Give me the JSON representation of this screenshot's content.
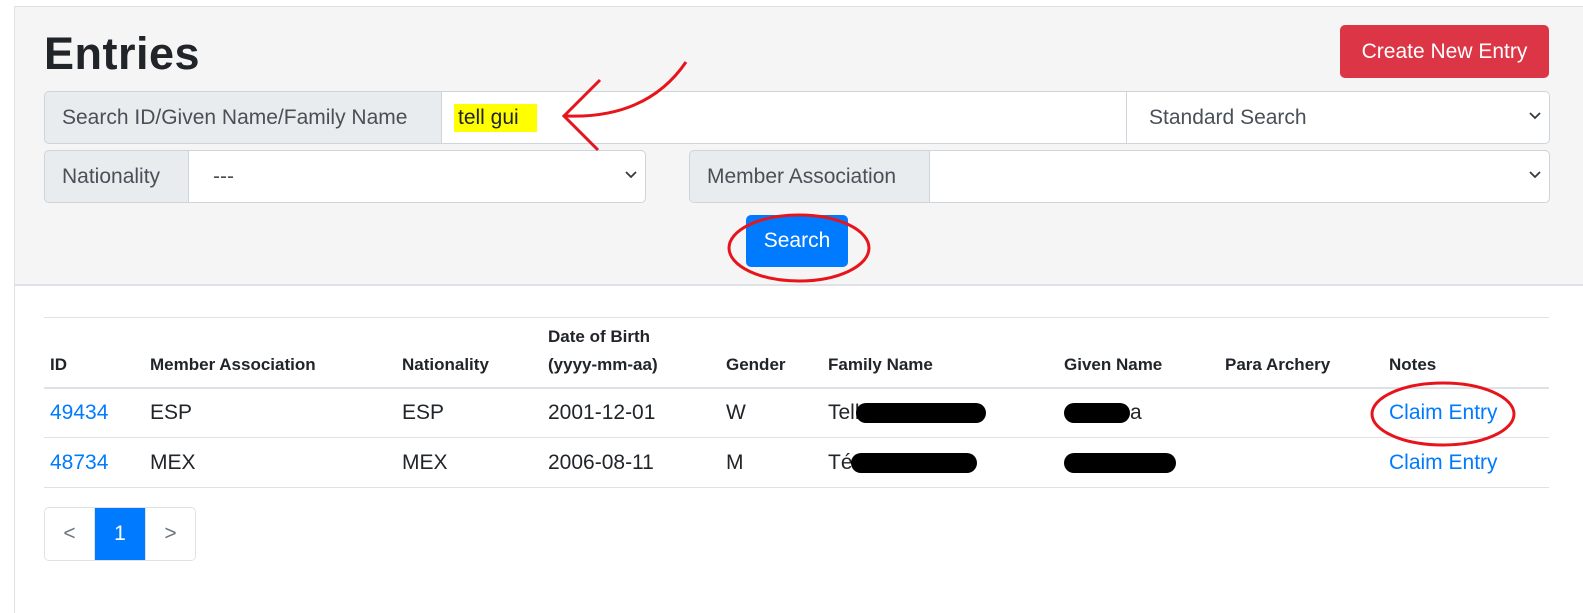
{
  "header": {
    "title": "Entries",
    "create_label": "Create New Entry"
  },
  "search": {
    "label": "Search ID/Given Name/Family Name",
    "value": "tell gui",
    "mode": "Standard Search"
  },
  "filters": {
    "nationality_label": "Nationality",
    "nationality_value": "---",
    "member_association_label": "Member Association",
    "member_association_value": ""
  },
  "search_button": "Search",
  "table": {
    "columns": [
      "ID",
      "Member Association",
      "Nationality",
      "Date of Birth (yyyy-mm-aa)",
      "Gender",
      "Family Name",
      "Given Name",
      "Para Archery",
      "Notes"
    ],
    "column_dob_line1": "Date of Birth",
    "column_dob_line2": "(yyyy-mm-aa)",
    "rows": [
      {
        "id": "49434",
        "member_association": "ESP",
        "nationality": "ESP",
        "dob": "2001-12-01",
        "gender": "W",
        "family_name_visible": "Tell",
        "given_name_visible": "a",
        "para_archery": "",
        "notes": "Claim Entry"
      },
      {
        "id": "48734",
        "member_association": "MEX",
        "nationality": "MEX",
        "dob": "2006-08-11",
        "gender": "M",
        "family_name_visible": "Té",
        "given_name_visible": "",
        "para_archery": "",
        "notes": "Claim Entry"
      }
    ]
  },
  "pagination": {
    "prev": "<",
    "current": "1",
    "next": ">"
  },
  "annotations": {
    "color": "#e8141b"
  }
}
